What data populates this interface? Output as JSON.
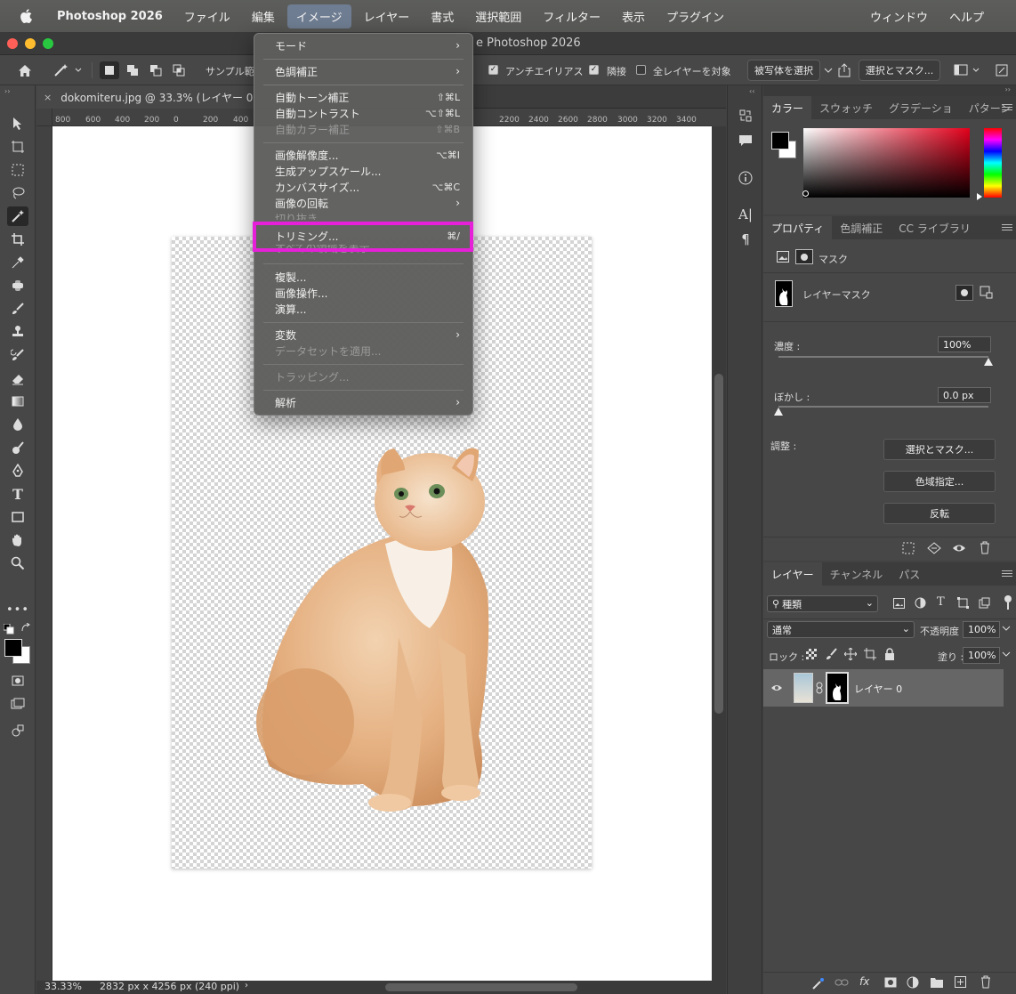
{
  "menubar": {
    "app": "Photoshop 2026",
    "items": [
      "ファイル",
      "編集",
      "イメージ",
      "レイヤー",
      "書式",
      "選択範囲",
      "フィルター",
      "表示",
      "プラグイン"
    ],
    "right_items": [
      "ウィンドウ",
      "ヘルプ"
    ],
    "active_item": "イメージ"
  },
  "window": {
    "title": "e Photoshop 2026"
  },
  "options_bar": {
    "sample_label": "サンプル範",
    "antialias_label": "アンチエイリアス",
    "contiguous_label": "隣接",
    "all_layers_label": "全レイヤーを対象",
    "select_subject": "被写体を選択",
    "select_and_mask": "選択とマスク..."
  },
  "document": {
    "tab_title": "dokomiteru.jpg @ 33.3% (レイヤー 0,",
    "ruler_ticks": [
      "800",
      "600",
      "400",
      "200",
      "0",
      "200",
      "400",
      "2200",
      "2400",
      "2600",
      "2800",
      "3000",
      "3200",
      "3400"
    ],
    "zoom": "33.33%",
    "dimensions": "2832 px x 4256 px (240 ppi)"
  },
  "image_menu": {
    "items": [
      {
        "label": "モード",
        "shortcut": "",
        "submenu": true,
        "disabled": false
      },
      {
        "label": "色調補正",
        "shortcut": "",
        "submenu": true,
        "disabled": false
      },
      {
        "label": "自動トーン補正",
        "shortcut": "⇧⌘L",
        "submenu": false,
        "disabled": false
      },
      {
        "label": "自動コントラスト",
        "shortcut": "⌥⇧⌘L",
        "submenu": false,
        "disabled": false
      },
      {
        "label": "自動カラー補正",
        "shortcut": "⇧⌘B",
        "submenu": false,
        "disabled": true
      },
      {
        "label": "画像解像度...",
        "shortcut": "⌥⌘I",
        "submenu": false,
        "disabled": false
      },
      {
        "label": "生成アップスケール...",
        "shortcut": "",
        "submenu": false,
        "disabled": false
      },
      {
        "label": "カンバスサイズ...",
        "shortcut": "⌥⌘C",
        "submenu": false,
        "disabled": false
      },
      {
        "label": "画像の回転",
        "shortcut": "",
        "submenu": true,
        "disabled": false
      },
      {
        "label": "切り抜き",
        "shortcut": "",
        "submenu": false,
        "disabled": true
      },
      {
        "label": "トリミング...",
        "shortcut": "⌘/",
        "submenu": false,
        "disabled": false
      },
      {
        "label": "すべての領域を表示",
        "shortcut": "",
        "submenu": false,
        "disabled": true
      },
      {
        "label": "複製...",
        "shortcut": "",
        "submenu": false,
        "disabled": false
      },
      {
        "label": "画像操作...",
        "shortcut": "",
        "submenu": false,
        "disabled": false
      },
      {
        "label": "演算...",
        "shortcut": "",
        "submenu": false,
        "disabled": false
      },
      {
        "label": "変数",
        "shortcut": "",
        "submenu": true,
        "disabled": false
      },
      {
        "label": "データセットを適用...",
        "shortcut": "",
        "submenu": false,
        "disabled": true
      },
      {
        "label": "トラッピング...",
        "shortcut": "",
        "submenu": false,
        "disabled": true
      },
      {
        "label": "解析",
        "shortcut": "",
        "submenu": true,
        "disabled": false
      }
    ],
    "highlight_color": "#e620d8"
  },
  "color_panel": {
    "tabs": [
      "カラー",
      "スウォッチ",
      "グラデーショ",
      "パターン"
    ]
  },
  "properties_panel": {
    "tabs": [
      "プロパティ",
      "色調補正",
      "CC ライブラリ"
    ],
    "mask_label": "マスク",
    "layer_mask_label": "レイヤーマスク",
    "density_label": "濃度 :",
    "density_value": "100%",
    "density_level": 1.0,
    "feather_label": "ぼかし :",
    "feather_value": "0.0 px",
    "feather_level": 0.0,
    "adjust_label": "調整 :",
    "btn_select_mask": "選択とマスク...",
    "btn_color_range": "色域指定...",
    "btn_invert": "反転"
  },
  "layers_panel": {
    "tabs": [
      "レイヤー",
      "チャンネル",
      "パス"
    ],
    "filter_kind": "種類",
    "blend_mode": "通常",
    "opacity_label": "不透明度 :",
    "opacity_value": "100%",
    "lock_label": "ロック :",
    "fill_label": "塗り :",
    "fill_value": "100%",
    "layer_name": "レイヤー 0"
  },
  "colors": {
    "menubar_active": "#6f7d92",
    "highlight_box": "#e620d8"
  }
}
